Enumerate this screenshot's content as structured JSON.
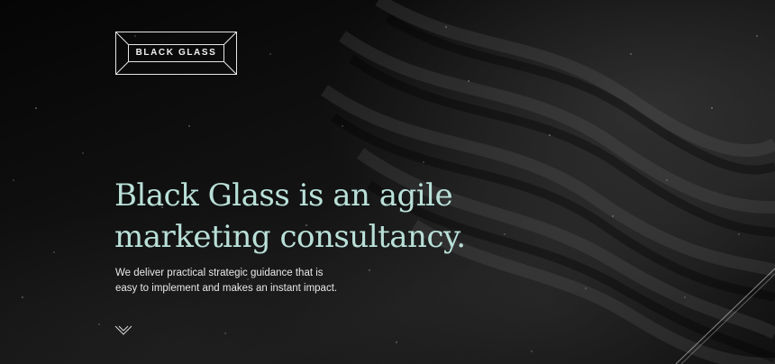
{
  "brand": {
    "logo_text": "BLACK GLASS"
  },
  "hero": {
    "headline_line1": "Black Glass is an agile",
    "headline_line2": "marketing consultancy.",
    "subtext_line1": "We deliver practical strategic guidance that is",
    "subtext_line2": "easy to implement and makes an instant impact."
  },
  "icons": {
    "scroll": "chevron-down-icon"
  },
  "colors": {
    "background": "#0b0b0b",
    "headline": "#b9e0d8",
    "text": "#e8e8e8",
    "logo": "#f2f2f2"
  }
}
